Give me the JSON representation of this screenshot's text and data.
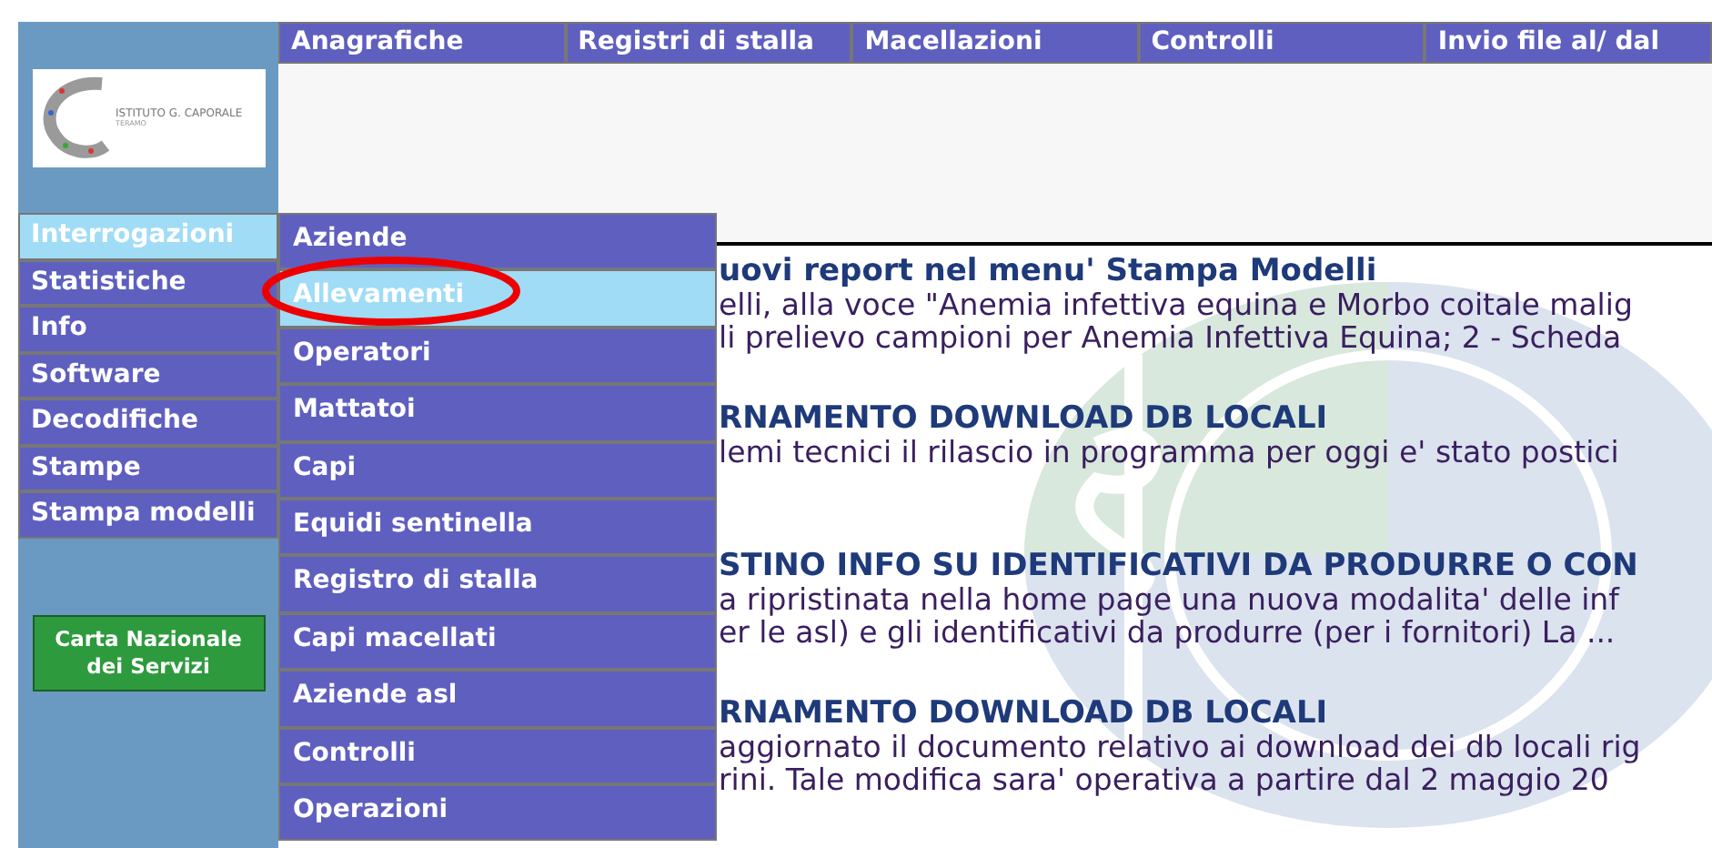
{
  "logo": {
    "name": "ISTITUTO G. CAPORALE",
    "subtitle": "TERAMO"
  },
  "top_nav": [
    {
      "label": "Anagrafiche"
    },
    {
      "label": "Registri di stalla"
    },
    {
      "label": "Macellazioni"
    },
    {
      "label": "Controlli"
    },
    {
      "label": "Invio file al/ dal"
    }
  ],
  "sidebar": [
    {
      "label": "Interrogazioni",
      "selected": true
    },
    {
      "label": "Statistiche",
      "selected": false
    },
    {
      "label": "Info",
      "selected": false
    },
    {
      "label": "Software",
      "selected": false
    },
    {
      "label": "Decodifiche",
      "selected": false
    },
    {
      "label": "Stampe",
      "selected": false
    },
    {
      "label": "Stampa modelli",
      "selected": false
    }
  ],
  "cns_button": {
    "line_1": "Carta Nazionale",
    "line_2": "dei Servizi"
  },
  "submenu": [
    {
      "label": "Aziende",
      "selected": false,
      "circled": false
    },
    {
      "label": "Allevamenti",
      "selected": true,
      "circled": true
    },
    {
      "label": "Operatori",
      "selected": false,
      "circled": false
    },
    {
      "label": "Mattatoi",
      "selected": false,
      "circled": false
    },
    {
      "label": "Capi",
      "selected": false,
      "circled": false
    },
    {
      "label": "Equidi sentinella",
      "selected": false,
      "circled": false
    },
    {
      "label": "Registro di stalla",
      "selected": false,
      "circled": false
    },
    {
      "label": "Capi macellati",
      "selected": false,
      "circled": false
    },
    {
      "label": "Aziende asl",
      "selected": false,
      "circled": false
    },
    {
      "label": "Controlli",
      "selected": false,
      "circled": false
    },
    {
      "label": "Operazioni",
      "selected": false,
      "circled": false
    }
  ],
  "news": [
    {
      "title": "uovi report nel menu' Stampa Modelli",
      "lines": [
        "elli, alla voce \"Anemia infettiva equina e Morbo coitale malig",
        "li prelievo campioni per Anemia Infettiva Equina; 2 - Scheda"
      ]
    },
    {
      "title": "RNAMENTO DOWNLOAD DB LOCALI",
      "lines": [
        "lemi tecnici il rilascio in programma per oggi e' stato postici"
      ]
    },
    {
      "title": "STINO INFO SU IDENTIFICATIVI DA PRODURRE O CON",
      "lines": [
        "a ripristinata nella home page una nuova modalita' delle inf",
        "er le asl) e gli identificativi da produrre (per i fornitori) La ..."
      ]
    },
    {
      "title": "RNAMENTO DOWNLOAD DB LOCALI",
      "lines": [
        "aggiornato il documento relativo ai download dei db locali rig",
        "rini. Tale modifica sara' operativa a partire dal 2 maggio 20"
      ]
    }
  ]
}
